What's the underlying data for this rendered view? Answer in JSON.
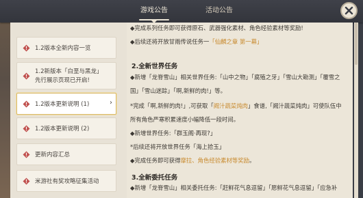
{
  "header": {
    "tabs": [
      {
        "label": "游戏公告",
        "active": true
      },
      {
        "label": "活动公告",
        "active": false
      }
    ]
  },
  "sidebar": {
    "items": [
      {
        "label": "1.2版本全新内容一览",
        "active": false
      },
      {
        "label_line1": "1.2新版本「白垩与黑龙」",
        "label_line2": "先行展示页现已开启!",
        "active": false
      },
      {
        "label": "1.2版本更新说明 (1)",
        "active": true
      },
      {
        "label": "1.2版本更新说明 (2)",
        "active": false
      },
      {
        "label": "更新内容汇总",
        "active": false
      },
      {
        "label": "米游社有奖攻略征集活动",
        "active": false
      }
    ]
  },
  "content": {
    "line1": "◆完成系列任务即可获得原石、武器强化素材、角色经验素材等奖励!",
    "line2_prefix": "◆后续还将开放甘雨传说任务一",
    "line2_highlight": "「仙麟之章 第一幕」",
    "section2_title": "2.全新世界任务",
    "line3": "◆新增「龙脊雪山」相关世界任务:「山中之物」「腐殖之牙」「雪山大勘测」「覆雪之",
    "line4": "国」「雪山迷踪」「啊,新鲜的肉!」等。",
    "line5_prefix": "*完成「啊,新鲜的肉!」,可获取「",
    "line5_highlight": "阙汁蔬菜炖肉",
    "line5_suffix": "」食谱,「阙汁蔬菜炖肉」可使队伍中",
    "line6": "所有角色严寒积累速度小幅降低一段时间。",
    "line7": "◆新增世界任务:「群玉阁·再现?」",
    "line8": "*后续还将开放世界任务「海上拾玉」",
    "line9_prefix": "◆完成任务即可获得",
    "line9_highlight": "摩拉、角色经验素材等奖励",
    "line9_suffix": "。",
    "section3_title": "3.全新委托任务",
    "line10": "◆新增「龙脊雪山」相关委托任务:「赶鲜花气息逗留」「愿鲜花气息逗留」「应急补"
  },
  "colors": {
    "accent_highlight": "#c88a2e",
    "active_border": "#d9b96a",
    "alert_icon": "#c0504d"
  },
  "icons": [
    "alert-diamond-icon",
    "chevron-right-icon",
    "close-icon"
  ]
}
